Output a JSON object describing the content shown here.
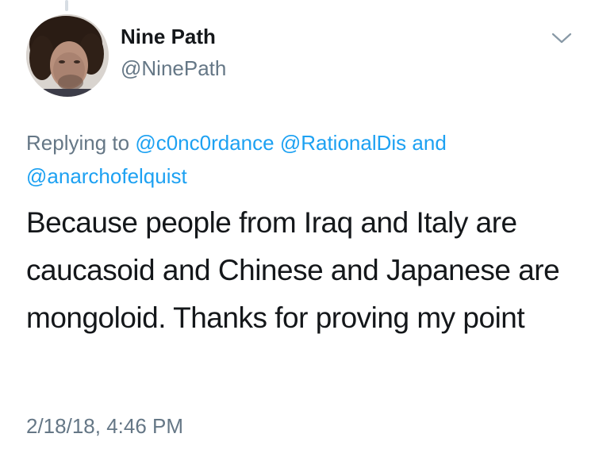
{
  "tweet": {
    "author": {
      "display_name": "Nine Path",
      "handle": "@NinePath",
      "avatar": "profile-photo"
    },
    "menu_icon": "chevron-down-icon",
    "replying": {
      "prefix": "Replying to",
      "mentions": [
        "@c0nc0rdance",
        "@RationalDis",
        "@anarchofelquist"
      ],
      "conjunction": "and"
    },
    "text": "Because people from Iraq and Italy are caucasoid and Chinese and Japanese are mongoloid. Thanks for proving my point",
    "timestamp": "2/18/18, 4:46 PM"
  },
  "colors": {
    "text": "#14171a",
    "secondary": "#657786",
    "link": "#1da1f2"
  }
}
